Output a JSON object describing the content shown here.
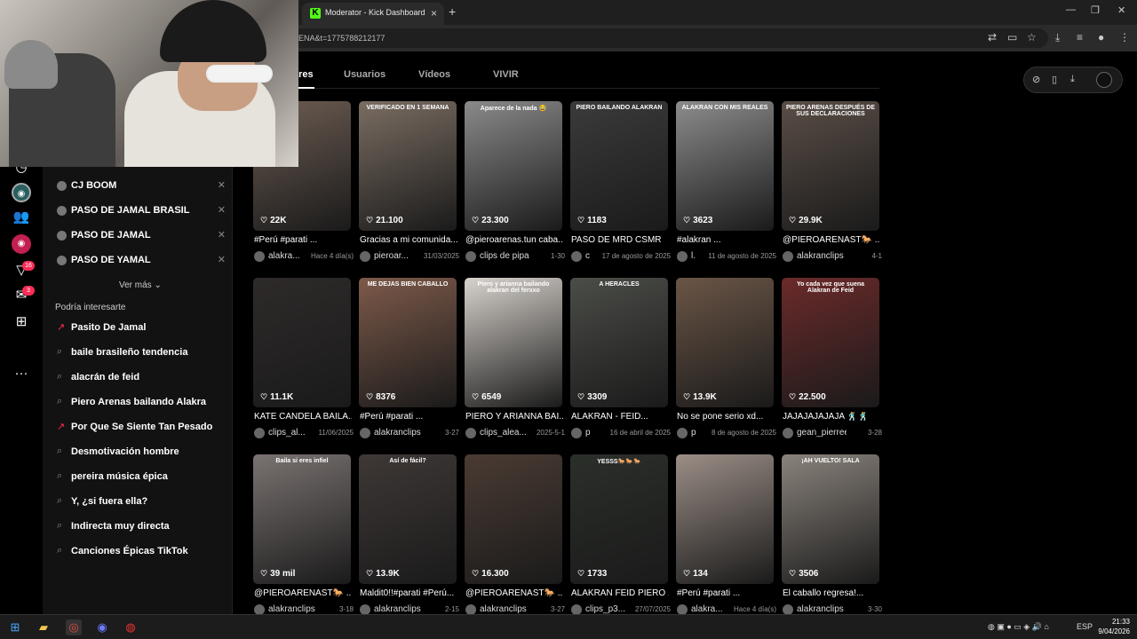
{
  "browser": {
    "tab_title": "Moderator - Kick Dashboard",
    "tab_close": "×",
    "new_tab": "+",
    "url": "ENA&t=1775788212177",
    "window_min": "—",
    "window_max": "❐",
    "window_close": "✕"
  },
  "rail": {
    "badge_inbox": "16",
    "badge_messages": "3",
    "more": "···"
  },
  "history": [
    {
      "label": "CJ BOOM"
    },
    {
      "label": "PASO DE JAMAL BRASIL"
    },
    {
      "label": "PASO DE JAMAL"
    },
    {
      "label": "PASO DE YAMAL"
    }
  ],
  "see_more": "Ver más",
  "suggest_title": "Podría interesarte",
  "suggestions": [
    {
      "label": "Pasito De Jamal",
      "trending": true
    },
    {
      "label": "baile brasileño tendencia",
      "trending": false
    },
    {
      "label": "alacrán de feid",
      "trending": false
    },
    {
      "label": "Piero Arenas bailando Alakra",
      "trending": false
    },
    {
      "label": "Por Que Se Siente Tan Pesado",
      "trending": true
    },
    {
      "label": "Desmotivación hombre",
      "trending": false
    },
    {
      "label": "pereira música épica",
      "trending": false
    },
    {
      "label": "Y, ¿si fuera ella?",
      "trending": false
    },
    {
      "label": "Indirecta muy directa",
      "trending": false
    },
    {
      "label": "Canciones Épicas TikTok",
      "trending": false
    }
  ],
  "tabs": [
    {
      "label": "ares"
    },
    {
      "label": "Usuarios"
    },
    {
      "label": "Vídeos"
    },
    {
      "label": "VIVIR"
    }
  ],
  "videos": [
    {
      "likes": "22K",
      "caption": "#Perú #parati ...",
      "user": "alakra...",
      "date": "Hace 4 día(s)",
      "overlay": "",
      "color": "#6d5d52"
    },
    {
      "likes": "21.100",
      "caption": "Gracias a mi comunida...",
      "user": "pieroar...",
      "date": "31/03/2025",
      "overlay": "VERIFICADO EN 1 SEMANA",
      "color": "#7a6d62"
    },
    {
      "likes": "23.300",
      "caption": "@pieroarenas.tun caba...",
      "user": "clips de pipa",
      "date": "1-30",
      "overlay": "Aparece de la nada 😂",
      "color": "#8a8a8a"
    },
    {
      "likes": "1183",
      "caption": "PASO DE MRD CSMR",
      "user": "c",
      "date": "17 de agosto de 2025",
      "overlay": "PIERO BAILANDO ALAKRAN",
      "color": "#3b3b3b"
    },
    {
      "likes": "3623",
      "caption": "#alakran ...",
      "user": "l.",
      "date": "11 de agosto de 2025",
      "overlay": "ALAKRAN CON MIS REALES",
      "color": "#8c8c8c"
    },
    {
      "likes": "29.9K",
      "caption": "@PIEROARENAST🐎 ...",
      "user": "alakranclips",
      "date": "4-1",
      "overlay": "PIERO ARENAS DESPUÉS DE SUS DECLARACIONES",
      "color": "#5a4e46"
    },
    {
      "likes": "11.1K",
      "caption": "KATE CANDELA BAILA...",
      "user": "clips_al...",
      "date": "11/06/2025",
      "overlay": "",
      "color": "#2e2a2a"
    },
    {
      "likes": "8376",
      "caption": "#Perú #parati ...",
      "user": "alakranclips",
      "date": "3-27",
      "overlay": "ME DEJAS BIEN CABALLO",
      "color": "#7d5a4a"
    },
    {
      "likes": "6549",
      "caption": "PIERO Y ARIANNA BAI...",
      "user": "clips_alea...",
      "date": "2025-5-1",
      "overlay": "Piero y arianna bailando alakran del ferxxo",
      "color": "#d7d2cc"
    },
    {
      "likes": "3309",
      "caption": "ALAKRAN - FEID...",
      "user": "p",
      "date": "16 de abril de 2025",
      "overlay": "A HERACLES",
      "color": "#4b4d48"
    },
    {
      "likes": "13.9K",
      "caption": "No se pone serio xd...",
      "user": "p",
      "date": "8 de agosto de 2025",
      "overlay": "",
      "color": "#6a5546"
    },
    {
      "likes": "22.500",
      "caption": "JAJAJAJAJAJA 🕺🕺",
      "user": "gean_pierreee",
      "date": "3-28",
      "overlay": "Yo cada vez que suena Alakran de Feid",
      "color": "#6b2a2a"
    },
    {
      "likes": "39 mil",
      "caption": "@PIEROARENAST🐎 ...",
      "user": "alakranclips",
      "date": "3-18",
      "overlay": "Baila si eres infiel",
      "color": "#7a7371"
    },
    {
      "likes": "13.9K",
      "caption": "Maldit0!!#parati #Perú...",
      "user": "alakranclips",
      "date": "2-15",
      "overlay": "Así de fácil?",
      "color": "#3e3836"
    },
    {
      "likes": "16.300",
      "caption": "@PIEROARENAST🐎 ...",
      "user": "alakranclips",
      "date": "3-27",
      "overlay": "",
      "color": "#4a3b33"
    },
    {
      "likes": "1733",
      "caption": "ALAKRAN FEID PIERO ...",
      "user": "clips_p3...",
      "date": "27/07/2025",
      "overlay": "YESSS🐎🐎🐎",
      "color": "#2b2f2a"
    },
    {
      "likes": "134",
      "caption": "#Perú #parati ...",
      "user": "alakra...",
      "date": "Hace 4 día(s)",
      "overlay": "",
      "color": "#9b8e86"
    },
    {
      "likes": "3506",
      "caption": "El caballo regresa!...",
      "user": "alakranclips",
      "date": "3-30",
      "overlay": "¡AH VUELTO! SALA",
      "color": "#8a837c"
    }
  ],
  "taskbar": {
    "time": "21:33",
    "date": "9/04/2026",
    "lang": "ESP"
  }
}
